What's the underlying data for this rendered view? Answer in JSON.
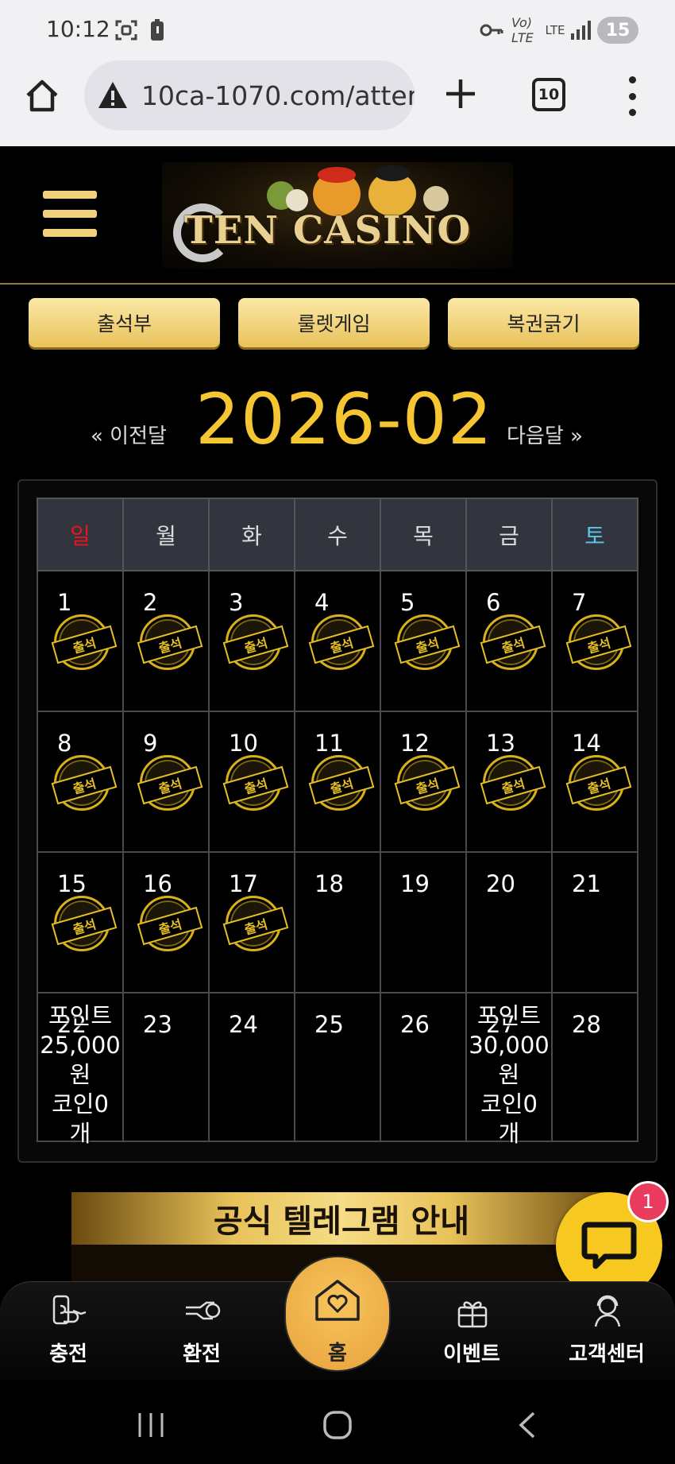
{
  "status_bar": {
    "time": "10:12",
    "left_icons": [
      "screenshot-icon",
      "battery-icon"
    ],
    "right_icons": [
      "key-icon",
      "volte-icon",
      "lte-icon",
      "signal-icon"
    ],
    "volte_label": "Vo) LTE",
    "lte_label": "LTE",
    "badge": "15"
  },
  "browser": {
    "url": "10ca-1070.com/atter",
    "tab_count": "10"
  },
  "header": {
    "logo_text": "TEN CASINO"
  },
  "top_buttons": [
    "출석부",
    "룰렛게임",
    "복권긁기"
  ],
  "month_nav": {
    "prev": "« 이전달",
    "title": "2026-02",
    "next": "다음달 »"
  },
  "calendar": {
    "weekdays": [
      "일",
      "월",
      "화",
      "수",
      "목",
      "금",
      "토"
    ],
    "stamp_label": "출석",
    "weeks": [
      [
        {
          "day": "1",
          "stamped": true
        },
        {
          "day": "2",
          "stamped": true
        },
        {
          "day": "3",
          "stamped": true
        },
        {
          "day": "4",
          "stamped": true
        },
        {
          "day": "5",
          "stamped": true
        },
        {
          "day": "6",
          "stamped": true
        },
        {
          "day": "7",
          "stamped": true
        }
      ],
      [
        {
          "day": "8",
          "stamped": true
        },
        {
          "day": "9",
          "stamped": true
        },
        {
          "day": "10",
          "stamped": true
        },
        {
          "day": "11",
          "stamped": true
        },
        {
          "day": "12",
          "stamped": true
        },
        {
          "day": "13",
          "stamped": true
        },
        {
          "day": "14",
          "stamped": true
        }
      ],
      [
        {
          "day": "15",
          "stamped": true
        },
        {
          "day": "16",
          "stamped": true
        },
        {
          "day": "17",
          "stamped": true
        },
        {
          "day": "18",
          "stamped": false
        },
        {
          "day": "19",
          "stamped": false
        },
        {
          "day": "20",
          "stamped": false
        },
        {
          "day": "21",
          "stamped": false
        }
      ],
      [
        {
          "day": "22",
          "stamped": false,
          "reward": [
            "포인트",
            "25,000",
            "원",
            "코인0",
            "개"
          ]
        },
        {
          "day": "23",
          "stamped": false
        },
        {
          "day": "24",
          "stamped": false
        },
        {
          "day": "25",
          "stamped": false
        },
        {
          "day": "26",
          "stamped": false
        },
        {
          "day": "27",
          "stamped": false,
          "reward": [
            "포인트",
            "30,000",
            "원",
            "코인0",
            "개"
          ]
        },
        {
          "day": "28",
          "stamped": false
        }
      ]
    ]
  },
  "banner": {
    "title": "공식 텔레그램 안내"
  },
  "chat": {
    "badge": "1"
  },
  "bottom_nav": {
    "items": [
      {
        "label": "충전",
        "icon": "deposit-icon"
      },
      {
        "label": "환전",
        "icon": "withdraw-icon"
      },
      {
        "label": "홈",
        "icon": "home-heart-icon"
      },
      {
        "label": "이벤트",
        "icon": "gift-icon"
      },
      {
        "label": "고객센터",
        "icon": "support-icon"
      }
    ]
  },
  "colors": {
    "accent_gold": "#f6c632",
    "button_gold": "#e9c25a",
    "sunday": "#e8141e",
    "saturday": "#5cc6ea",
    "chat_yellow": "#f6c820",
    "badge_red": "#e83b5e"
  }
}
